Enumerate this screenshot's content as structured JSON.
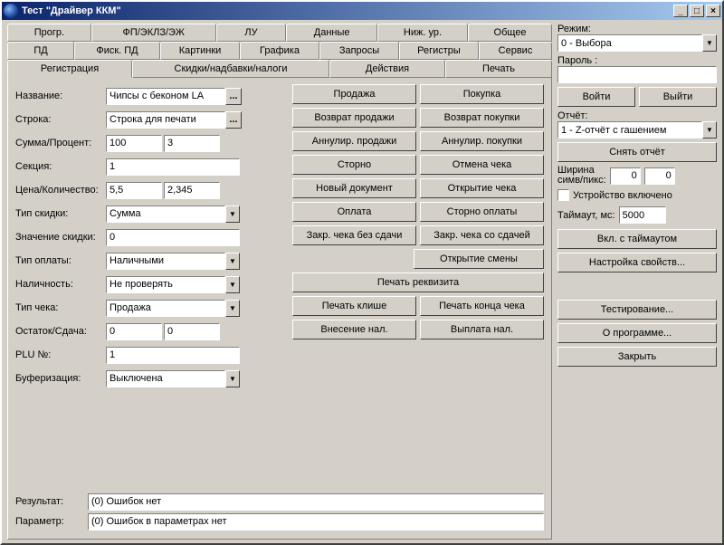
{
  "window": {
    "title": "Тест \"Драйвер ККМ\""
  },
  "tabs_top1": [
    "Прогр.",
    "ФП/ЭКЛЗ/ЭЖ",
    "ЛУ",
    "Данные",
    "Ниж. ур.",
    "Общее"
  ],
  "tabs_top2": [
    "ПД",
    "Фиск. ПД",
    "Картинки",
    "Графика",
    "Запросы",
    "Регистры",
    "Сервис"
  ],
  "tabs_top3": [
    "Регистрация",
    "Скидки/надбавки/налоги",
    "Действия",
    "Печать"
  ],
  "tabs_top3_active": 0,
  "form": {
    "name_lbl": "Название:",
    "name_val": "Чипсы с беконом LA",
    "line_lbl": "Строка:",
    "line_val": "Строка для печати",
    "sumpct_lbl": "Сумма/Процент:",
    "sum_val": "100",
    "pct_val": "3",
    "section_lbl": "Секция:",
    "section_val": "1",
    "priceqty_lbl": "Цена/Количество:",
    "price_val": "5,5",
    "qty_val": "2,345",
    "disc_type_lbl": "Тип скидки:",
    "disc_type_val": "Сумма",
    "disc_val_lbl": "Значение скидки:",
    "disc_val_val": "0",
    "pay_type_lbl": "Тип оплаты:",
    "pay_type_val": "Наличными",
    "cash_lbl": "Наличность:",
    "cash_val": "Не проверять",
    "check_type_lbl": "Тип чека:",
    "check_type_val": "Продажа",
    "rest_lbl": "Остаток/Сдача:",
    "rest_a": "0",
    "rest_b": "0",
    "plu_lbl": "PLU №:",
    "plu_val": "1",
    "buf_lbl": "Буферизация:",
    "buf_val": "Выключена"
  },
  "ops": {
    "sale": "Продажа",
    "buy": "Покупка",
    "ret_sale": "Возврат продажи",
    "ret_buy": "Возврат покупки",
    "annul_sale": "Аннулир. продажи",
    "annul_buy": "Аннулир. покупки",
    "storno": "Сторно",
    "cancel_check": "Отмена чека",
    "new_doc": "Новый документ",
    "open_check": "Открытие чека",
    "pay": "Оплата",
    "storno_pay": "Сторно оплаты",
    "close_nochange": "Закр. чека без сдачи",
    "close_change": "Закр. чека со сдачей",
    "open_shift": "Открытие смены",
    "print_req": "Печать реквизита",
    "print_cliche": "Печать клише",
    "print_end": "Печать конца чека",
    "cash_in": "Внесение нал.",
    "cash_out": "Выплата нал."
  },
  "footer": {
    "result_lbl": "Результат:",
    "result_val": "(0) Ошибок нет",
    "param_lbl": "Параметр:",
    "param_val": "(0) Ошибок в параметрах нет"
  },
  "right": {
    "mode_lbl": "Режим:",
    "mode_val": "0 - Выбора",
    "pass_lbl": "Пароль :",
    "pass_val": "",
    "login": "Войти",
    "logout": "Выйти",
    "report_lbl": "Отчёт:",
    "report_val": "1 - Z-отчёт с гашением",
    "do_report": "Снять отчёт",
    "width_lbl": "Ширина\nсимв/пикс:",
    "width_a": "0",
    "width_b": "0",
    "device_on": "Устройство включено",
    "timeout_lbl": "Таймаут, мс:",
    "timeout_val": "5000",
    "on_timeout": "Вкл. с таймаутом",
    "props": "Настройка свойств...",
    "test": "Тестирование...",
    "about": "О программе...",
    "close": "Закрыть"
  }
}
